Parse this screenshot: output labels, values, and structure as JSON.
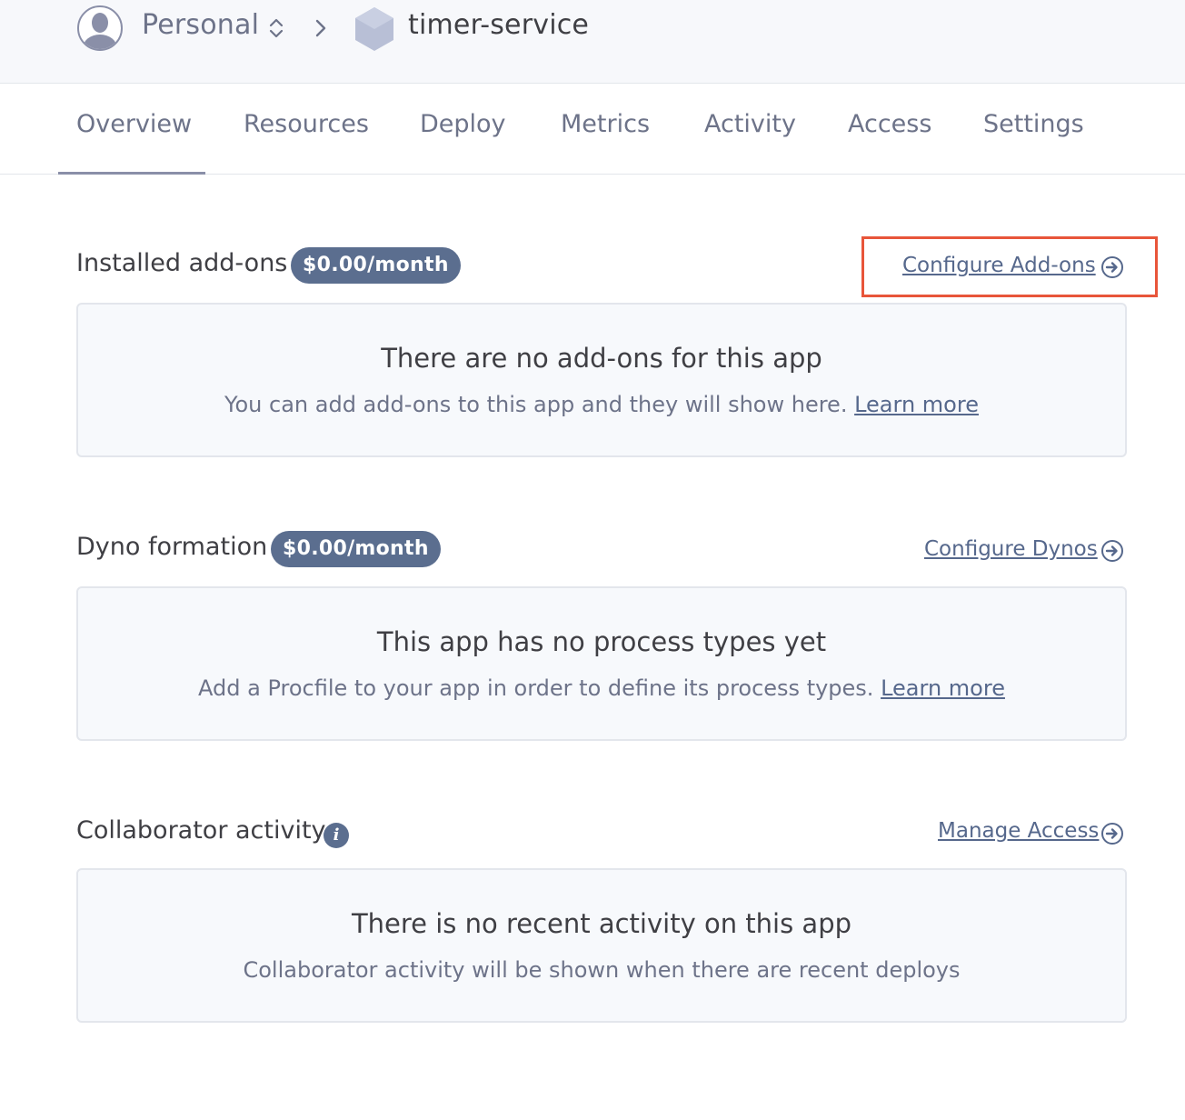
{
  "breadcrumb": {
    "account": "Personal",
    "app": "timer-service"
  },
  "tabs": [
    {
      "label": "Overview",
      "active": true
    },
    {
      "label": "Resources"
    },
    {
      "label": "Deploy"
    },
    {
      "label": "Metrics"
    },
    {
      "label": "Activity"
    },
    {
      "label": "Access"
    },
    {
      "label": "Settings"
    }
  ],
  "addons": {
    "title": "Installed add-ons",
    "cost": "$0.00/month",
    "link": "Configure Add-ons",
    "empty_title": "There are no add-ons for this app",
    "empty_desc": "You can add add-ons to this app and they will show here.",
    "learn_more": "Learn more"
  },
  "dynos": {
    "title": "Dyno formation",
    "cost": "$0.00/month",
    "link": "Configure Dynos",
    "empty_title": "This app has no process types yet",
    "empty_desc": "Add a Procfile to your app in order to define its process types.",
    "learn_more": "Learn more"
  },
  "collaborators": {
    "title": "Collaborator activity",
    "link": "Manage Access",
    "empty_title": "There is no recent activity on this app",
    "empty_desc": "Collaborator activity will be shown when there are recent deploys"
  },
  "icons": {
    "avatar": "user-avatar-icon",
    "switcher": "updown-chevron-icon",
    "separator": "chevron-right-icon",
    "app": "hexagon-app-icon",
    "link_arrow": "circle-arrow-right-icon",
    "info": "info-icon"
  },
  "colors": {
    "accent": "#5b6e8f",
    "link": "#56688c",
    "highlight": "#e8553a"
  }
}
